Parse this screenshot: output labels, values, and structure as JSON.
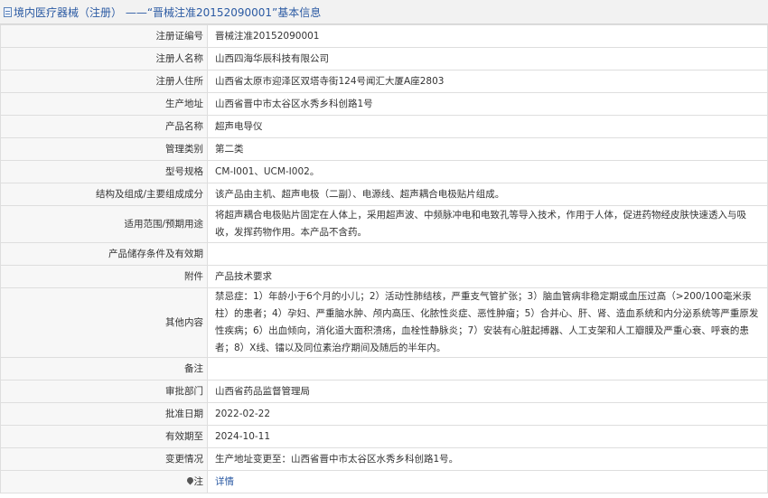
{
  "header": {
    "title": "境内医疗器械（注册） ——“晋械注准20152090001”基本信息"
  },
  "rows": {
    "reg_no": {
      "label": "注册证编号",
      "value": "晋械注准20152090001"
    },
    "registrant": {
      "label": "注册人名称",
      "value": "山西四海华辰科技有限公司"
    },
    "registrant_address": {
      "label": "注册人住所",
      "value": "山西省太原市迎泽区双塔寺街124号闻汇大厦A座2803"
    },
    "production_address": {
      "label": "生产地址",
      "value": "山西省晋中市太谷区水秀乡科创路1号"
    },
    "product_name": {
      "label": "产品名称",
      "value": "超声电导仪"
    },
    "category": {
      "label": "管理类别",
      "value": "第二类"
    },
    "model": {
      "label": "型号规格",
      "value": "CM-Ⅰ001、UCM-Ⅰ002。"
    },
    "structure": {
      "label": "结构及组成/主要组成成分",
      "value": "该产品由主机、超声电极（二副）、电源线、超声耦合电极贴片组成。"
    },
    "scope": {
      "label": "适用范围/预期用途",
      "value": "将超声耦合电极贴片固定在人体上，采用超声波、中频脉冲电和电致孔等导入技术，作用于人体，促进药物经皮肤快速透入与吸收，发挥药物作用。本产品不含药。"
    },
    "storage": {
      "label": "产品储存条件及有效期",
      "value": ""
    },
    "attachment": {
      "label": "附件",
      "value": "产品技术要求"
    },
    "other": {
      "label": "其他内容",
      "value": "禁忌症：1）年龄小于6个月的小儿；2）活动性肺结核，严重支气管扩张；3）脑血管病非稳定期或血压过高（>200/100毫米汞柱）的患者；4）孕妇、严重脑水肿、颅内高压、化脓性炎症、恶性肿瘤；5）合并心、肝、肾、造血系统和内分泌系统等严重原发性疾病；6）出血倾向，消化道大面积溃疡，血栓性静脉炎；7）安装有心脏起搏器、人工支架和人工瓣膜及严重心衰、呼衰的患者；8）X线、镭以及同位素治疗期间及随后的半年内。"
    },
    "remark": {
      "label": "备注",
      "value": ""
    },
    "authority": {
      "label": "审批部门",
      "value": "山西省药品监督管理局"
    },
    "approval_date": {
      "label": "批准日期",
      "value": "2022-02-22"
    },
    "expiry_date": {
      "label": "有效期至",
      "value": "2024-10-11"
    },
    "change": {
      "label": "变更情况",
      "value": "生产地址变更至：山西省晋中市太谷区水秀乡科创路1号。"
    },
    "note": {
      "label": "注",
      "link_text": "详情",
      "icon": "pin-icon"
    }
  }
}
